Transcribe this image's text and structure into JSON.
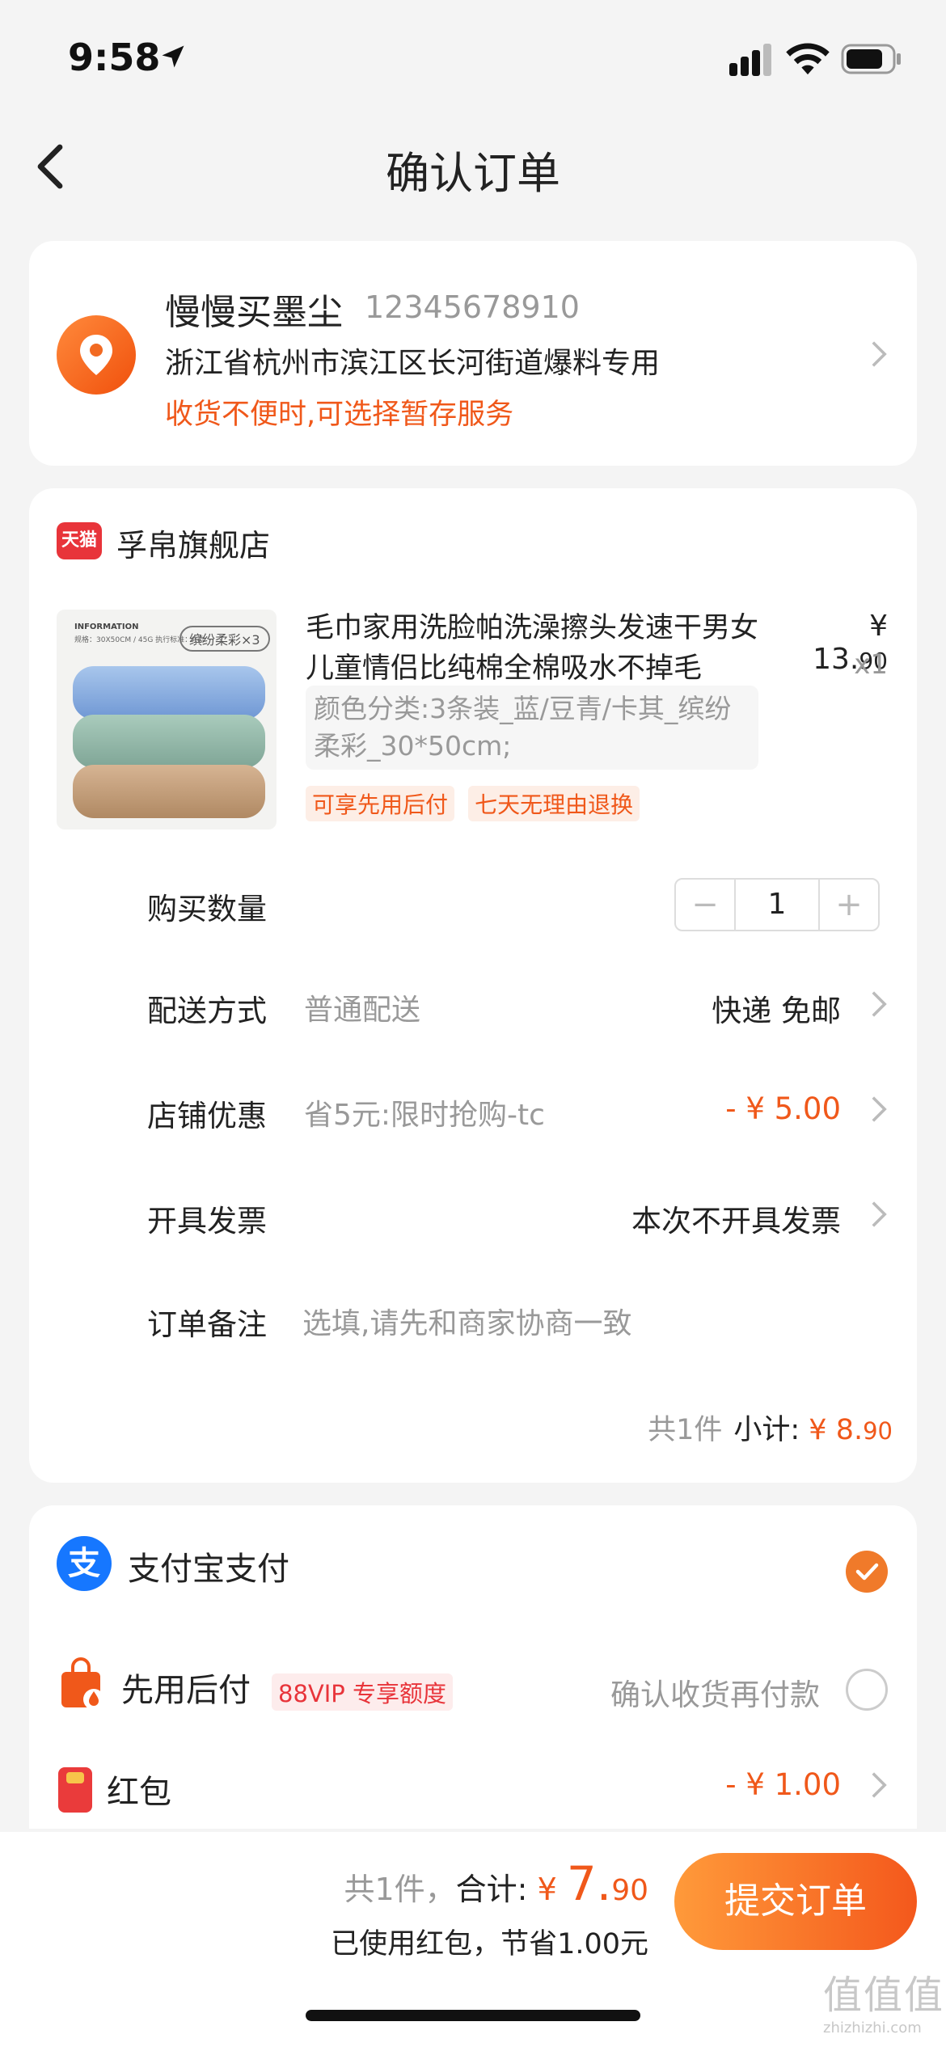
{
  "status_bar": {
    "time": "9:58"
  },
  "nav": {
    "title": "确认订单"
  },
  "address": {
    "name": "慢慢买墨尘",
    "phone": "12345678910",
    "line": "浙江省杭州市滨江区长河街道爆料专用",
    "note": "收货不便时,可选择暂存服务"
  },
  "shop": {
    "logo_text": "天猫",
    "name": "孚帛旗舰店"
  },
  "product": {
    "title": "毛巾家用洗脸帕洗澡擦头发速干男女儿童情侣比纯棉全棉吸水不掉毛",
    "price_main": "¥ 13.",
    "price_small": "90",
    "qty": "x1",
    "spec": "颜色分类:3条装_蓝/豆青/卡其_缤纷柔彩_30*50cm;",
    "badges": [
      "可享先用后付",
      "七天无理由退换"
    ],
    "image_info_title": "INFORMATION",
    "image_info_detail": "规格：30X50CM / 45G  执行标准：A类",
    "image_tag": "缤纷柔彩×3"
  },
  "rows": {
    "quantity_label": "购买数量",
    "quantity_value": "1",
    "minus": "−",
    "plus": "+",
    "shipping_label": "配送方式",
    "shipping_sub": "普通配送",
    "shipping_value": "快递 免邮",
    "discount_label": "店铺优惠",
    "discount_sub": "省5元:限时抢购-tc",
    "discount_value": "- ¥ 5.00",
    "invoice_label": "开具发票",
    "invoice_value": "本次不开具发票",
    "remark_label": "订单备注",
    "remark_placeholder": "选填,请先和商家协商一致"
  },
  "subtotal": {
    "count": "共1件",
    "label": "小计:",
    "amount_main": "¥ 8.",
    "amount_small": "90"
  },
  "payment": {
    "alipay_icon": "支",
    "alipay_label": "支付宝支付",
    "pay_later_label": "先用后付",
    "vip_tag": "88VIP 专享额度",
    "pay_later_note": "确认收货再付款",
    "hongbao_label": "红包",
    "hongbao_value": "- ¥ 1.00"
  },
  "footer": {
    "count": "共1件，",
    "total_label": "合计:",
    "total_currency": "¥ ",
    "total_big": "7.",
    "total_small": "90",
    "saved": "已使用红包，节省1.00元",
    "submit": "提交订单"
  },
  "watermark": {
    "big": "值值值",
    "small": "zhizhizhi.com"
  },
  "colors": {
    "accent": "#f0581a",
    "alipay": "#1677ff",
    "tmall": "#e8343a"
  },
  "icons": [
    "location-arrow-icon",
    "signal-icon",
    "wifi-icon",
    "battery-icon",
    "back-icon",
    "location-pin-icon",
    "chevron-right-icon",
    "tmall-icon",
    "alipay-icon",
    "check-icon",
    "bag-icon",
    "hongbao-icon"
  ]
}
